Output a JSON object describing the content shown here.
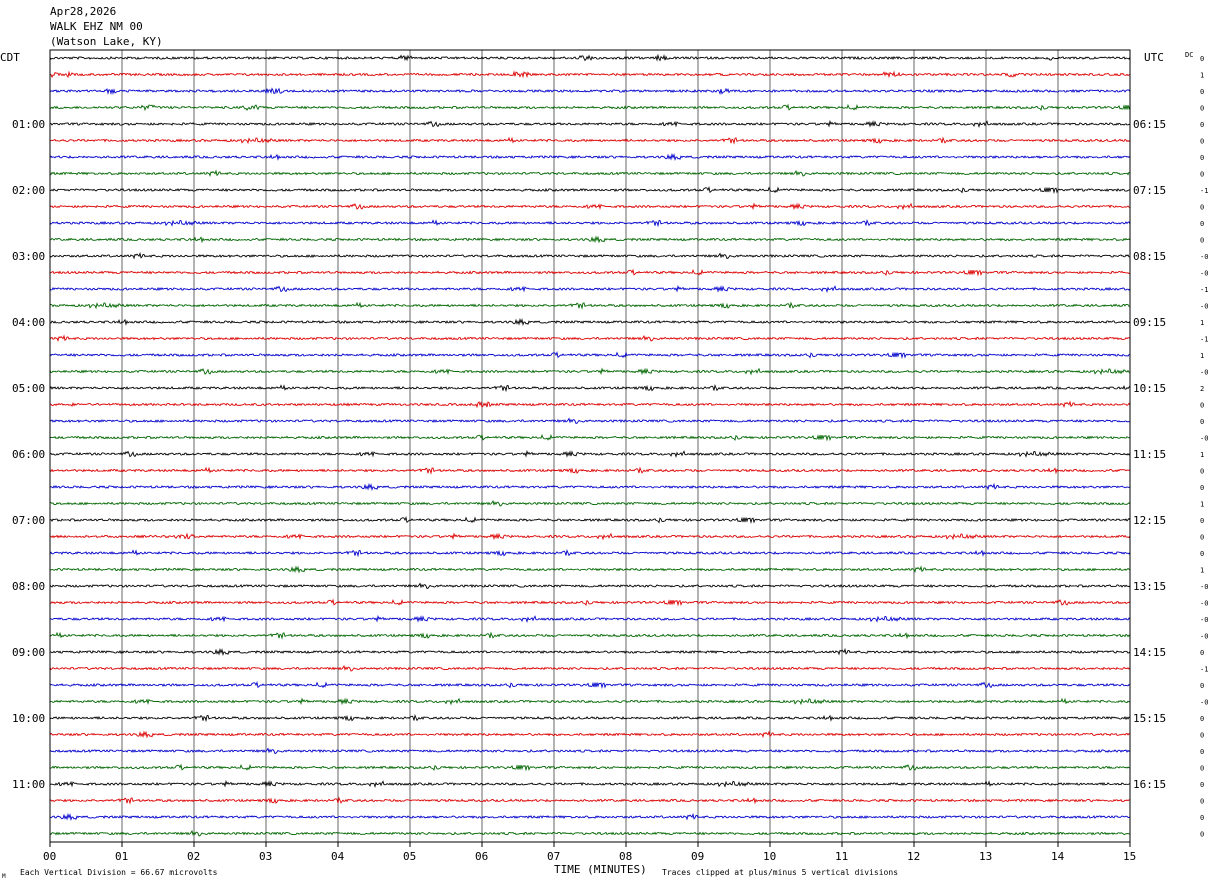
{
  "header": {
    "date": "Apr28,2026",
    "station": "WALK EHZ NM 00",
    "location": "(Watson Lake, KY)"
  },
  "left_tz": "CDT",
  "right_tz": "UTC",
  "dc_label": "DC",
  "colors": {
    "trace_cycle": [
      "#000000",
      "#dd0000",
      "#0000cc",
      "#006600"
    ],
    "grid": "#000000",
    "frame": "#000000"
  },
  "chart_data": {
    "type": "line",
    "title": "WALK EHZ NM 00",
    "xlabel": "TIME (MINUTES)",
    "x_ticks": [
      "00",
      "01",
      "02",
      "03",
      "04",
      "05",
      "06",
      "07",
      "08",
      "09",
      "10",
      "11",
      "12",
      "13",
      "14",
      "15"
    ],
    "xlim": [
      0,
      15
    ],
    "trace_count": 48,
    "minutes_per_trace": 15,
    "left_hour_labels": [
      "01:00",
      "02:00",
      "03:00",
      "04:00",
      "05:00",
      "06:00",
      "07:00",
      "08:00",
      "09:00",
      "10:00",
      "11:00"
    ],
    "right_hour_labels": [
      "06:15",
      "07:15",
      "08:15",
      "09:15",
      "10:15",
      "11:15",
      "12:15",
      "13:15",
      "14:15",
      "15:15",
      "16:15"
    ],
    "dc_offsets": [
      "0",
      "1",
      "0",
      "0",
      "0",
      "0",
      "0",
      "0",
      "-1",
      "0",
      "0",
      "0",
      "-0",
      "-0",
      "-1",
      "-0",
      "1",
      "-1",
      "1",
      "-0",
      "2",
      "0",
      "0",
      "-0",
      "1",
      "0",
      "0",
      "1",
      "0",
      "0",
      "0",
      "1",
      "-0",
      "-0",
      "-0",
      "-0",
      "0",
      "-1",
      "0",
      "-0",
      "0",
      "0",
      "0",
      "0",
      "0",
      "0",
      "0",
      "0"
    ]
  },
  "footer": {
    "scale_note": "Each Vertical Division =   66.67 microvolts",
    "clip_note": "Traces clipped at plus/minus 5 vertical divisions",
    "corner_mark": "M"
  }
}
